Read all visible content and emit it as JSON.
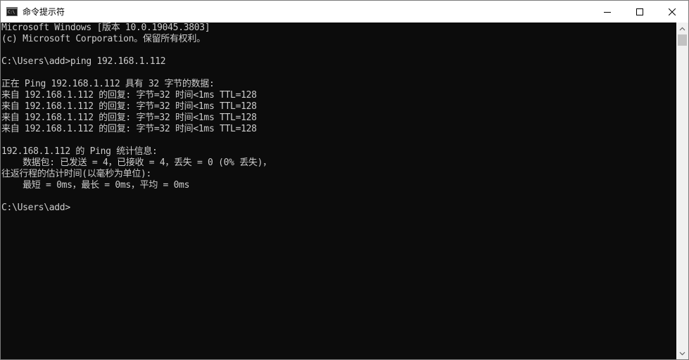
{
  "window": {
    "title": "命令提示符",
    "icon_label": "C:\\",
    "icon": "cmd-app-icon",
    "buttons": {
      "minimize": "minimize-icon",
      "maximize": "maximize-icon",
      "close": "close-icon"
    }
  },
  "console": {
    "lines": [
      "Microsoft Windows [版本 10.0.19045.3803]",
      "(c) Microsoft Corporation。保留所有权利。",
      "",
      "C:\\Users\\add>ping 192.168.1.112",
      "",
      "正在 Ping 192.168.1.112 具有 32 字节的数据:",
      "来自 192.168.1.112 的回复: 字节=32 时间<1ms TTL=128",
      "来自 192.168.1.112 的回复: 字节=32 时间<1ms TTL=128",
      "来自 192.168.1.112 的回复: 字节=32 时间<1ms TTL=128",
      "来自 192.168.1.112 的回复: 字节=32 时间<1ms TTL=128",
      "",
      "192.168.1.112 的 Ping 统计信息:",
      "    数据包: 已发送 = 4，已接收 = 4，丢失 = 0 (0% 丢失)，",
      "往返行程的估计时间(以毫秒为单位):",
      "    最短 = 0ms，最长 = 0ms，平均 = 0ms",
      "",
      "C:\\Users\\add>"
    ],
    "text_color": "#cccccc",
    "background_color": "#0c0c0c"
  }
}
